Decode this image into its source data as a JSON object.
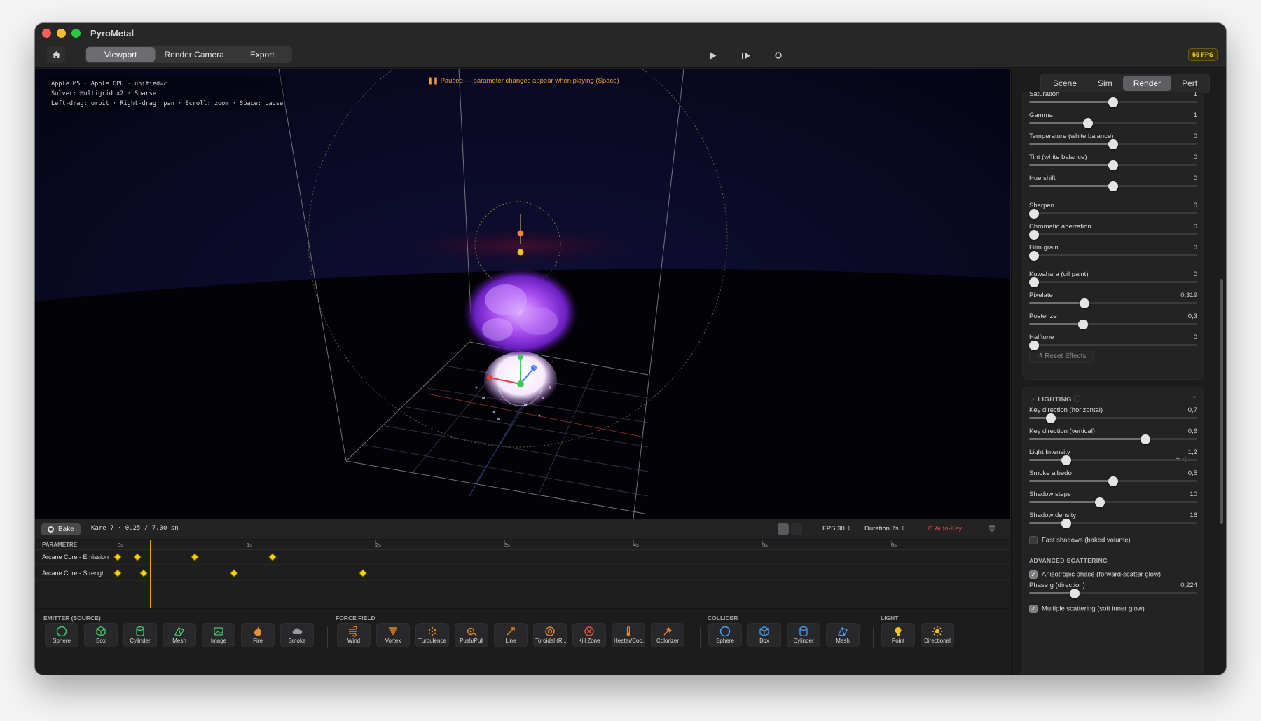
{
  "window": {
    "title": "PyroMetal"
  },
  "toolbar": {
    "tabs": [
      {
        "label": "Viewport",
        "active": true
      },
      {
        "label": "Render Camera"
      },
      {
        "label": "Export"
      }
    ],
    "fps_badge": "55 FPS",
    "icons": [
      "home-icon",
      "play-icon",
      "step-icon",
      "reset-icon"
    ]
  },
  "viewport": {
    "info_lines": [
      "Apple M5 · Apple GPU · unified=✓",
      "Solver: Multigrid ×2 · Sparse",
      "Left-drag: orbit · Right-drag: pan · Scroll: zoom · Space: pause"
    ],
    "paused_text": "Paused — parameter changes appear when playing (Space)",
    "colors": {
      "smoke": "#8b2fe0",
      "core": "#ffffff",
      "background": "#0a0a26"
    }
  },
  "panel": {
    "tabs": [
      {
        "label": "Scene"
      },
      {
        "label": "Sim"
      },
      {
        "label": "Render",
        "active": true
      },
      {
        "label": "Perf"
      }
    ],
    "effects": [
      {
        "label": "Saturation",
        "value": "1",
        "level": 0.5
      },
      {
        "label": "Gamma",
        "value": "1",
        "level": 0.35
      },
      {
        "label": "Temperature (white balance)",
        "value": "0",
        "level": 0.5
      },
      {
        "label": "Tint (white balance)",
        "value": "0",
        "level": 0.5
      },
      {
        "label": "Hue shift",
        "value": "0",
        "level": 0.5
      },
      {
        "label": "Sharpen",
        "value": "0",
        "level": 0.03
      },
      {
        "label": "Chromatic aberration",
        "value": "0",
        "level": 0.03
      },
      {
        "label": "Film grain",
        "value": "0",
        "level": 0.03
      },
      {
        "label": "Kuwahara (oil paint)",
        "value": "0",
        "level": 0.03
      },
      {
        "label": "Pixelate",
        "value": "0,319",
        "level": 0.33
      },
      {
        "label": "Posterize",
        "value": "0,3",
        "level": 0.32
      },
      {
        "label": "Halftone",
        "value": "0",
        "level": 0.03
      }
    ],
    "reset_label": "Reset Effects",
    "lighting": {
      "title": "LIGHTING",
      "sliders": [
        {
          "label": "Key direction (horizontal)",
          "value": "0,7",
          "level": 0.13
        },
        {
          "label": "Key direction (vertical)",
          "value": "0,6",
          "level": 0.69
        },
        {
          "label": "Light Intensity",
          "value": "1,2",
          "level": 0.22
        },
        {
          "label": "Smoke albedo",
          "value": "0,5",
          "level": 0.5
        },
        {
          "label": "Shadow steps",
          "value": "10",
          "level": 0.42
        },
        {
          "label": "Shadow density",
          "value": "16",
          "level": 0.22
        }
      ],
      "fast_shadows": {
        "label": "Fast shadows (baked volume)",
        "checked": false
      },
      "advanced_title": "ADVANCED SCATTERING",
      "anisotropic": {
        "label": "Anisotropic phase (forward-scatter glow)",
        "checked": true
      },
      "phase": {
        "label": "Phase g (direction)",
        "value": "0,224",
        "level": 0.27
      },
      "multiple": {
        "label": "Multiple scattering (soft inner glow)",
        "checked": true
      }
    }
  },
  "timeline": {
    "bake_label": "Bake",
    "frame_text": "Kare 7 · 0.25 / 7.00 sn",
    "fps_label": "FPS 30",
    "duration_label": "Duration 7s",
    "autokey_label": "Auto-Key",
    "param_header": "PARAMETRE",
    "ruler": [
      "0s",
      "1s",
      "2s",
      "3s",
      "4s",
      "5s",
      "6s"
    ],
    "tracks": [
      {
        "name": "Arcane Core - Emission",
        "keys": [
          0,
          0.15,
          0.6,
          1.2
        ]
      },
      {
        "name": "Arcane Core - Strength",
        "keys": [
          0,
          0.2,
          0.9,
          1.9
        ]
      }
    ],
    "playhead_seconds": 0.25
  },
  "palette": {
    "groups": [
      {
        "title": "EMITTER (SOURCE)",
        "items": [
          "Sphere",
          "Box",
          "Cylinder",
          "Mesh",
          "Image",
          "Fire",
          "Smoke"
        ]
      },
      {
        "title": "FORCE FIELD",
        "items": [
          "Wind",
          "Vortex",
          "Turbulence",
          "Push/Pull",
          "Line",
          "Toroidal (Ri...",
          "Kill Zone",
          "Heater/Coo...",
          "Colorizer"
        ]
      },
      {
        "title": "COLLIDER",
        "items": [
          "Sphere",
          "Box",
          "Cylinder",
          "Mesh"
        ]
      },
      {
        "title": "LIGHT",
        "items": [
          "Point",
          "Directional"
        ]
      }
    ]
  }
}
